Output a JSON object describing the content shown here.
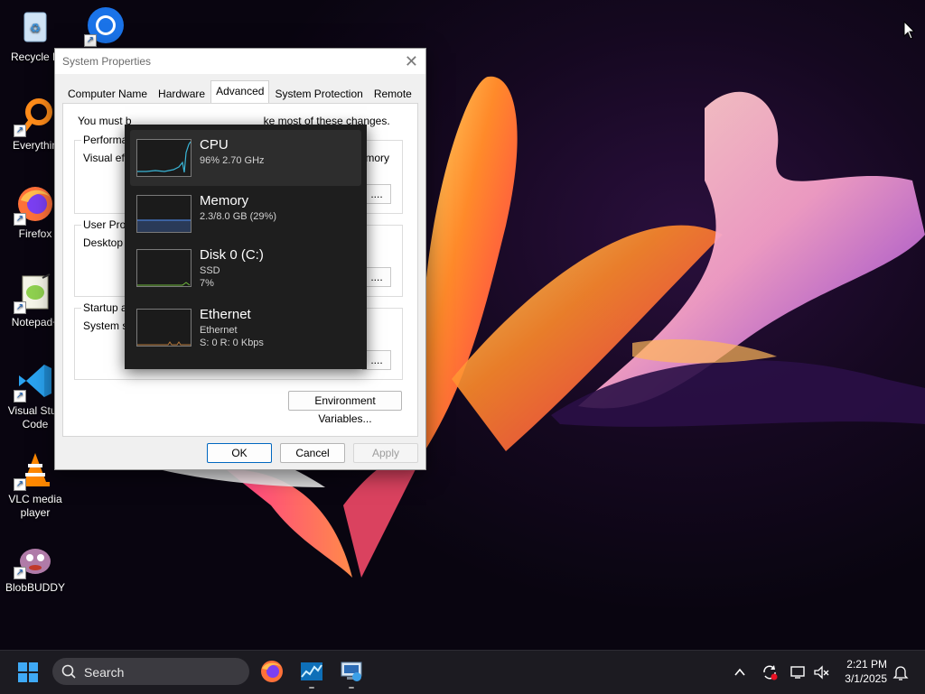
{
  "desktop": {
    "icons": [
      {
        "label": "Recycle Bin",
        "display": "Recycle B"
      },
      {
        "label": "Everything",
        "display": "Everythin"
      },
      {
        "label": "Firefox"
      },
      {
        "label": "Notepad++",
        "display": "Notepad+"
      },
      {
        "label": "Visual Studio Code",
        "line1": "Visual Stud",
        "line2": "Code"
      },
      {
        "label": "VLC media player",
        "line1": "VLC media",
        "line2": "player"
      },
      {
        "label": "BlobBUDDY"
      }
    ],
    "extra_icon": "chrome-icon"
  },
  "dialog": {
    "title": "System Properties",
    "tabs": [
      "Computer Name",
      "Hardware",
      "Advanced",
      "System Protection",
      "Remote"
    ],
    "active_tab": "Advanced",
    "note": "You must be logged on as an Administrator to make most of these changes.",
    "note_visible": "You must b",
    "note_tail": "ke most of these changes.",
    "groups": {
      "performance": {
        "label": "Performan",
        "text": "Visual effe",
        "right_text": "mory",
        "button": "...."
      },
      "user_profiles": {
        "label": "User Profil",
        "text": "Desktop s",
        "button": "...."
      },
      "startup": {
        "label": "Startup an",
        "text": "System sta",
        "button": "...."
      }
    },
    "env_button": "Environment Variables...",
    "ok": "OK",
    "cancel": "Cancel",
    "apply": "Apply"
  },
  "task_manager": {
    "items": [
      {
        "name": "CPU",
        "line1": "96% 2.70 GHz",
        "active": true,
        "graph_color": "#3ab5d6"
      },
      {
        "name": "Memory",
        "line1": "2.3/8.0 GB (29%)",
        "graph_color": "#4a7fd6"
      },
      {
        "name": "Disk 0 (C:)",
        "line1": "SSD",
        "line2": "7%",
        "graph_color": "#6fba3c"
      },
      {
        "name": "Ethernet",
        "line1": "Ethernet",
        "line2": "S: 0 R: 0 Kbps",
        "graph_color": "#b6773b"
      }
    ]
  },
  "taskbar": {
    "search_label": "Search",
    "apps": [
      "firefox-icon",
      "task-manager-icon",
      "system-properties-icon"
    ],
    "tray": [
      "chevron-up-icon",
      "sync-icon",
      "network-icon",
      "volume-muted-icon",
      "notification-bell-icon"
    ],
    "time": "2:21 PM",
    "date": "3/1/2025"
  },
  "colors": {
    "accent": "#3fa9f5",
    "taskbar": "#1c1b21"
  }
}
